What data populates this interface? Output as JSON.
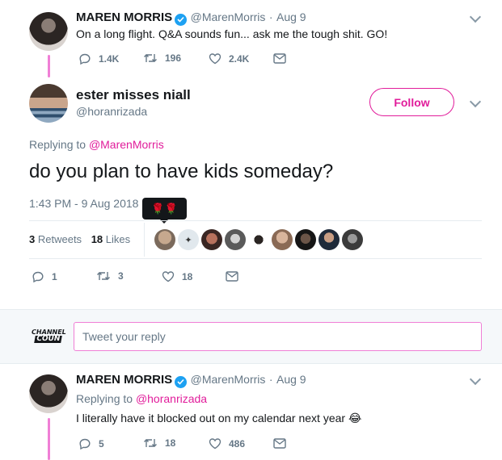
{
  "tweet1": {
    "name": "MAREN MORRIS",
    "handle": "@MarenMorris",
    "dot": "·",
    "date": "Aug 9",
    "text": "On a long flight. Q&A sounds fun... ask me the tough shit. GO!",
    "replies": "1.4K",
    "retweets": "196",
    "likes": "2.4K"
  },
  "main_tweet": {
    "name": "ester misses niall",
    "handle": "@horanrizada",
    "follow_label": "Follow",
    "replying_prefix": "Replying to",
    "replying_to": "@MarenMorris",
    "text": "do you plan to have kids someday?",
    "timestamp": "1:43 PM - 9 Aug 2018",
    "retweet_count": "3",
    "retweet_label": "Retweets",
    "like_count": "18",
    "like_label": "Likes",
    "tooltip": "🌹🌹",
    "actions": {
      "replies": "1",
      "retweets": "3",
      "likes": "18"
    }
  },
  "compose": {
    "avatar_text_line1": "CHANNEL",
    "avatar_text_line2": "COUN",
    "placeholder": "Tweet your reply"
  },
  "tweet2": {
    "name": "MAREN MORRIS",
    "handle": "@MarenMorris",
    "dot": "·",
    "date": "Aug 9",
    "replying_prefix": "Replying to",
    "replying_to": "@horanrizada",
    "text": "I literally have it blocked out on my calendar next year",
    "emoji": "😂",
    "replies": "5",
    "retweets": "18",
    "likes": "486"
  },
  "colors": {
    "accent": "#e11d9b",
    "thread": "#f07fd6",
    "verified": "#1da1f2",
    "muted": "#657786",
    "divider": "#e6ecf0",
    "compose_bg": "#f5f8fa"
  },
  "likers": [
    "liker-avatar",
    "liker-avatar",
    "liker-avatar",
    "liker-avatar",
    "liker-avatar",
    "liker-avatar",
    "liker-avatar",
    "liker-avatar",
    "liker-avatar"
  ]
}
